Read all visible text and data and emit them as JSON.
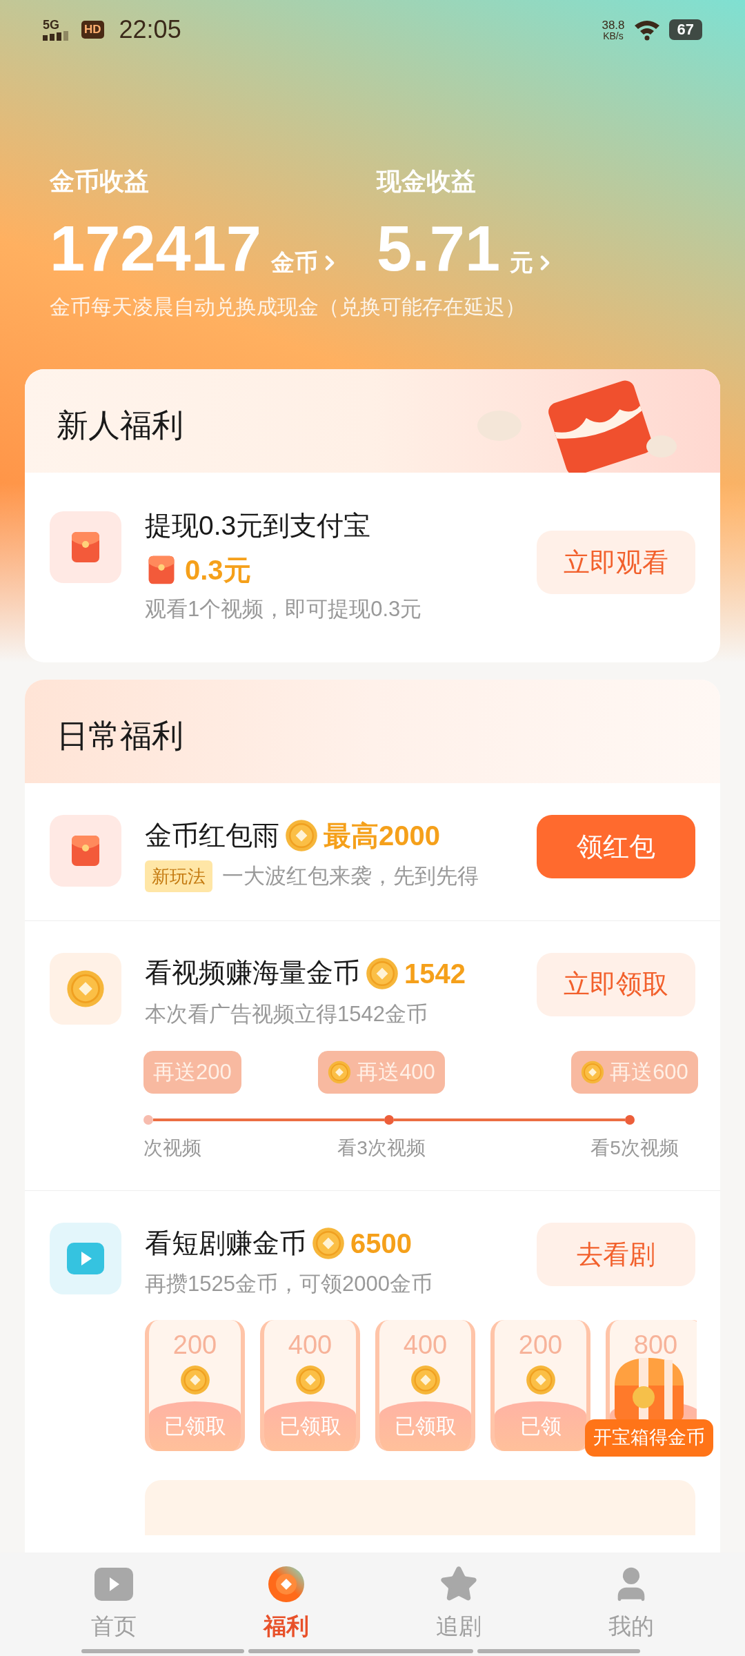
{
  "status_bar": {
    "network": "5G",
    "hd": "HD",
    "time": "22:05",
    "speed": "38.8",
    "speed_unit": "KB/s",
    "battery": "67"
  },
  "earnings": [
    {
      "label": "金币收益",
      "value": "172417",
      "unit": "金币"
    },
    {
      "label": "现金收益",
      "value": "5.71",
      "unit": "元"
    }
  ],
  "note": "金币每天凌晨自动兑换成现金（兑换可能存在延迟）",
  "newcomer": {
    "title": "新人福利",
    "items": [
      {
        "title": "提现0.3元到支付宝",
        "amount": "0.3元",
        "desc": "观看1个视频，即可提现0.3元",
        "button": {
          "label": "立即观看",
          "primary": false
        }
      }
    ]
  },
  "daily": {
    "title": "日常福利",
    "items": [
      {
        "kind": "promo",
        "title": "金币红包雨",
        "reward": "最高2000",
        "tag": "新玩法",
        "desc": "一大波红包来袭，先到先得",
        "button": {
          "label": "领红包",
          "primary": true
        }
      },
      {
        "kind": "progress",
        "title": "看视频赚海量金币",
        "reward": "1542",
        "desc": "本次看广告视频立得1542金币",
        "button": {
          "label": "立即领取",
          "primary": false
        },
        "milestones": [
          {
            "bonus": "再送200",
            "label": "次视频"
          },
          {
            "bonus": "再送400",
            "label": "看3次视频"
          },
          {
            "bonus": "再送600",
            "label": "看5次视频"
          }
        ]
      },
      {
        "kind": "cards",
        "title": "看短剧赚金币",
        "reward": "6500",
        "desc": "再攒1525金币，可领2000金币",
        "button": {
          "label": "去看剧",
          "primary": false
        },
        "cards": [
          {
            "amount": "200",
            "status": "已领取"
          },
          {
            "amount": "400",
            "status": "已领取"
          },
          {
            "amount": "400",
            "status": "已领取"
          },
          {
            "amount": "200",
            "status": "已领"
          },
          {
            "amount": "800"
          }
        ],
        "chest_badge": "开宝箱得金币"
      }
    ]
  },
  "nav": [
    {
      "label": "首页",
      "selected": false
    },
    {
      "label": "福利",
      "selected": true
    },
    {
      "label": "追剧",
      "selected": false
    },
    {
      "label": "我的",
      "selected": false
    }
  ]
}
